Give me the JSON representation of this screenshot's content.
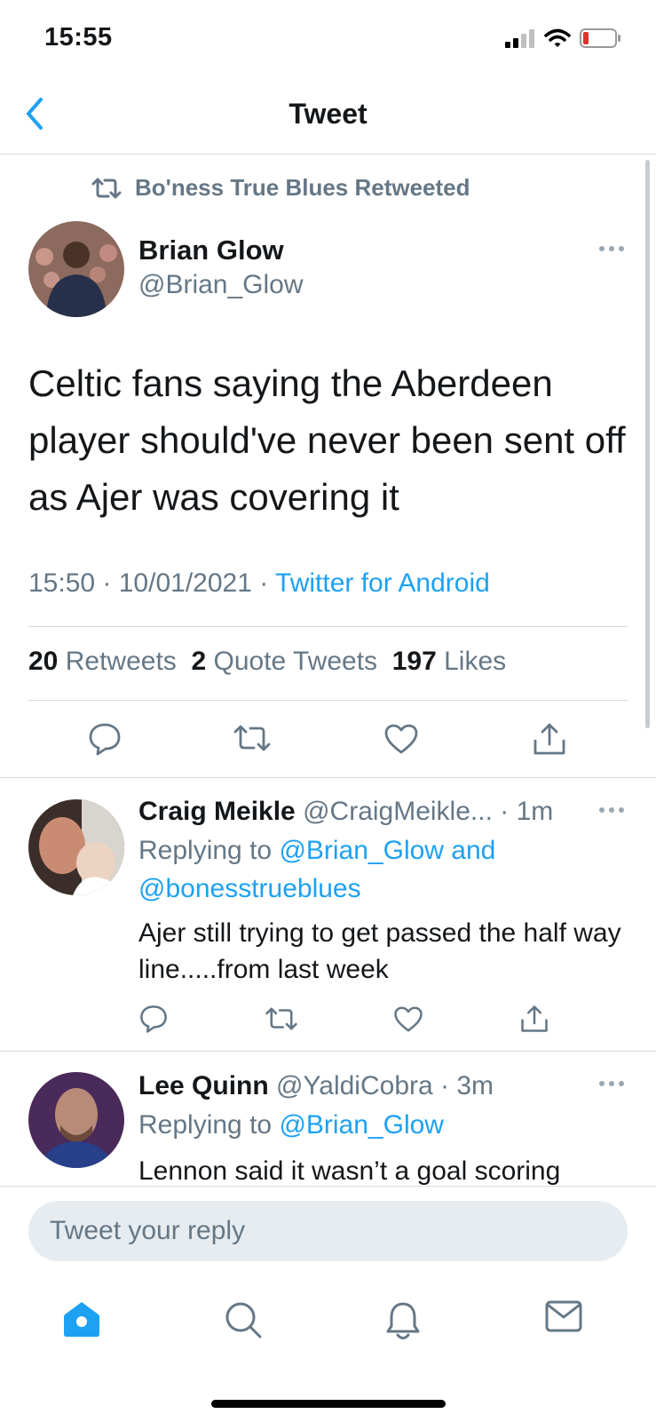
{
  "status": {
    "time": "15:55"
  },
  "nav": {
    "title": "Tweet"
  },
  "banner": {
    "text": "Bo'ness True Blues Retweeted"
  },
  "tweet": {
    "name": "Brian Glow",
    "handle": "@Brian_Glow",
    "text": "Celtic fans saying the Aberdeen player should've never been sent off as Ajer was covering it",
    "time": "15:50",
    "date": "10/01/2021",
    "source": "Twitter for Android",
    "retweets_count": "20",
    "retweets_label": "Retweets",
    "quotes_count": "2",
    "quotes_label": "Quote Tweets",
    "likes_count": "197",
    "likes_label": "Likes"
  },
  "replies": [
    {
      "name": "Craig Meikle",
      "handle": "@CraigMeikle...",
      "age": "1m",
      "replying_label": "Replying to",
      "replying_to": "@Brian_Glow and",
      "replying_to_2": "@bonesstrueblues",
      "text": "Ajer still trying to get passed the half way line.....from last week"
    },
    {
      "name": "Lee Quinn",
      "handle": "@YaldiCobra",
      "age": "3m",
      "replying_label": "Replying to",
      "replying_to": "@Brian_Glow",
      "text": "Lennon said it wasn’t a goal scoring"
    }
  ],
  "compose": {
    "placeholder": "Tweet your reply"
  },
  "colors": {
    "accent": "#1da1f2",
    "muted": "#657786",
    "text": "#14171a",
    "divider": "#d4dbe0"
  },
  "icons": [
    "cellular-signal-icon",
    "wifi-icon",
    "battery-low-icon",
    "back-chevron-icon",
    "retweet-icon",
    "more-icon",
    "reply-icon",
    "like-icon",
    "share-icon",
    "home-icon",
    "search-icon",
    "notifications-icon",
    "messages-icon"
  ]
}
